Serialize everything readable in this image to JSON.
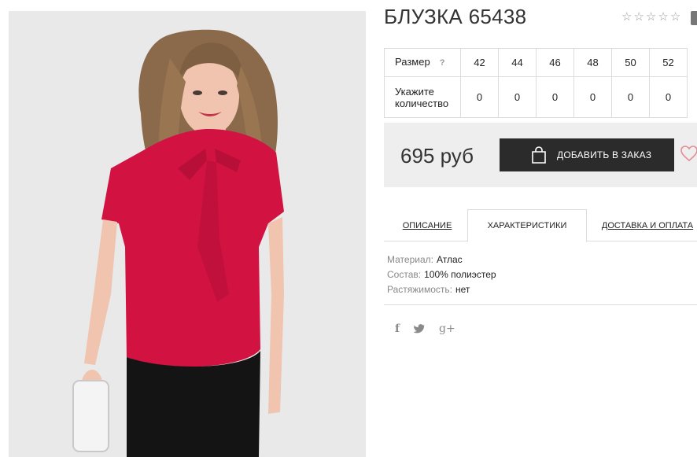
{
  "product": {
    "title": "БЛУЗКА 65438",
    "rating_stars": [
      "☆",
      "☆",
      "☆",
      "☆",
      "☆"
    ],
    "price": "695 руб",
    "add_to_cart_label": "ДОБАВИТЬ В ЗАКАЗ"
  },
  "size_table": {
    "size_label": "Размер",
    "help_icon": "?",
    "quantity_label": "Укажите количество",
    "sizes": [
      "42",
      "44",
      "46",
      "48",
      "50",
      "52"
    ],
    "quantities": [
      "0",
      "0",
      "0",
      "0",
      "0",
      "0"
    ]
  },
  "tabs": [
    {
      "label": "ОПИСАНИЕ",
      "active": false
    },
    {
      "label": "ХАРАКТЕРИСТИКИ",
      "active": true
    },
    {
      "label": "ДОСТАВКА И ОПЛАТА",
      "active": false
    }
  ],
  "characteristics": [
    {
      "key": "Материал:",
      "value": "Атлас"
    },
    {
      "key": "Состав:",
      "value": "100% полиэстер"
    },
    {
      "key": "Растяжимость:",
      "value": "нет"
    }
  ],
  "social": {
    "facebook": "f",
    "twitter": "🐦",
    "googleplus": "g+"
  },
  "icons": {
    "cart": "shopping-bag-icon",
    "wishlist": "heart-icon",
    "compare": "compare-icon"
  },
  "colors": {
    "button": "#2b2b2b",
    "buy_box": "#eeeeee",
    "heart": "#e58b94",
    "blouse": "#d21342"
  }
}
